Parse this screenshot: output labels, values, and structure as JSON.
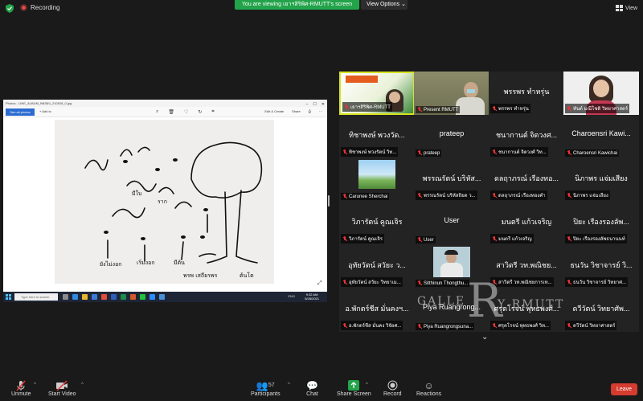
{
  "topbar": {
    "recording_label": "Recording",
    "viewing_banner": "You are viewing เยาฯสิริพิศ-RMUTT's screen",
    "view_options_label": "View Options",
    "view_label": "View",
    "banner_color": "#23a34a"
  },
  "share": {
    "window_title": "Photos - LINE_ALBUM_ทดสอบ_210528_0.jpg",
    "slideshow_label": "See all photos",
    "addto_label": "+ Add to",
    "share_label": "Share",
    "edit_label": "Edit & Create",
    "search_placeholder": "Type here to search",
    "clock_time": "9:32 AM",
    "clock_date": "5/28/2021",
    "tray_lang": "ENG"
  },
  "drawing": {
    "labels": [
      "ยังไม่งอก",
      "เริ่มงอก",
      "มีต้น",
      "มีใบ",
      "ต้นโต",
      "ราก"
    ],
    "signature": "พรพ เสถียรพร"
  },
  "participants": [
    {
      "big": "",
      "caption": "เยาฯสิริพิศ-RMUTT",
      "video": "banner",
      "active": true
    },
    {
      "big": "",
      "caption": "Present RMUTT",
      "video": "person",
      "active": false
    },
    {
      "big": "พรรพร ทำหรุ่น",
      "caption": "พรรพร ทำหรุ่น",
      "video": "",
      "active": false
    },
    {
      "big": "",
      "caption": "ทันต์ มณีโชติ วิทยาศาสตร์",
      "video": "woman",
      "active": false
    },
    {
      "big": "ทิชาพงษ์ พวงวัด...",
      "caption": "ทิชาพงษ์ พวงรัตน์ วิท...",
      "video": "",
      "active": false
    },
    {
      "big": "prateep",
      "caption": "prateep",
      "video": "",
      "active": false
    },
    {
      "big": "ชนากานต์ จิตวงศ...",
      "caption": "ชนากานต์ จิตวงศ์ วิท...",
      "video": "",
      "active": false
    },
    {
      "big": "Charoensri Kawi...",
      "caption": "Charoensri Kawichai",
      "video": "",
      "active": false
    },
    {
      "big": "",
      "caption": "Carunee Sherchai",
      "video": "sky",
      "active": false
    },
    {
      "big": "พรรณรัตน์ บริหัส...",
      "caption": "พรรณรัตน์ บริหัสถิยด ว...",
      "video": "",
      "active": false
    },
    {
      "big": "ดลฤาภรณ์ เรืองทอ...",
      "caption": "ดลฤาภรณ์ เรืองทองคำ",
      "video": "",
      "active": false
    },
    {
      "big": "นิภาพร แจ่มเสียง",
      "caption": "นิภาพร แจ่มเสียง",
      "video": "",
      "active": false
    },
    {
      "big": "วิภารัตน์ คูณเจิร",
      "caption": "วิภารัตน์ คูณเจิร",
      "video": "",
      "active": false
    },
    {
      "big": "User",
      "caption": "User",
      "video": "",
      "active": false
    },
    {
      "big": "มนตรี แก้วเจริญ",
      "caption": "มนตรี แก้วเจริญ",
      "video": "",
      "active": false
    },
    {
      "big": "ปิยะ เรืองรองลัพ...",
      "caption": "ปิยะ เรืองรองลัพธนานนท์",
      "video": "",
      "active": false
    },
    {
      "big": "อุทัยวัตน์ สวัยะ ว...",
      "caption": "อุทัยวัตน์ สวัยะ วิทยาเม...",
      "video": "",
      "active": false
    },
    {
      "big": "",
      "caption": "Sitthinun Thongthu...",
      "video": "man",
      "active": false
    },
    {
      "big": "สาวิตรี วท.พณิชย...",
      "caption": "สาวิตรี วท.พณิชยการเท...",
      "video": "",
      "active": false
    },
    {
      "big": "ธนวัน วิชาจารย์ วิ...",
      "caption": "ธนวัน วิชาจารย์ วิทยาศ...",
      "video": "",
      "active": false
    },
    {
      "big": "อ.พักตร์ชีส มั่นคงฯ...",
      "caption": "อ.พักตร์ชีส มั่นคง วิจัยศ...",
      "video": "",
      "active": false
    },
    {
      "big": "Piya Ruangrong...",
      "caption": "Piya Ruangrongsuna...",
      "video": "",
      "active": false
    },
    {
      "big": "ศรุตโรจน์ พุทธพงศ์...",
      "caption": "ศรุตโรจน์ พุทธพงศ์ วิท...",
      "video": "",
      "active": false
    },
    {
      "big": "ดวีวัตน์ วิทยาศัพ...",
      "caption": "ดวีวัตน์ วิทยาศาสตร์",
      "video": "",
      "active": false
    }
  ],
  "watermark": {
    "left": "GALLE",
    "mid": "R",
    "right": "RMUTT",
    "x": "Y"
  },
  "toolbar": {
    "unmute": "Unmute",
    "start_video": "Start Video",
    "participants": "Participants",
    "participants_count": "57",
    "chat": "Chat",
    "share_screen": "Share Screen",
    "record": "Record",
    "reactions": "Reactions",
    "leave": "Leave"
  },
  "colors": {
    "share_green": "#23a34a",
    "leave_red": "#d53b2f",
    "active_border": "#d7e321"
  }
}
